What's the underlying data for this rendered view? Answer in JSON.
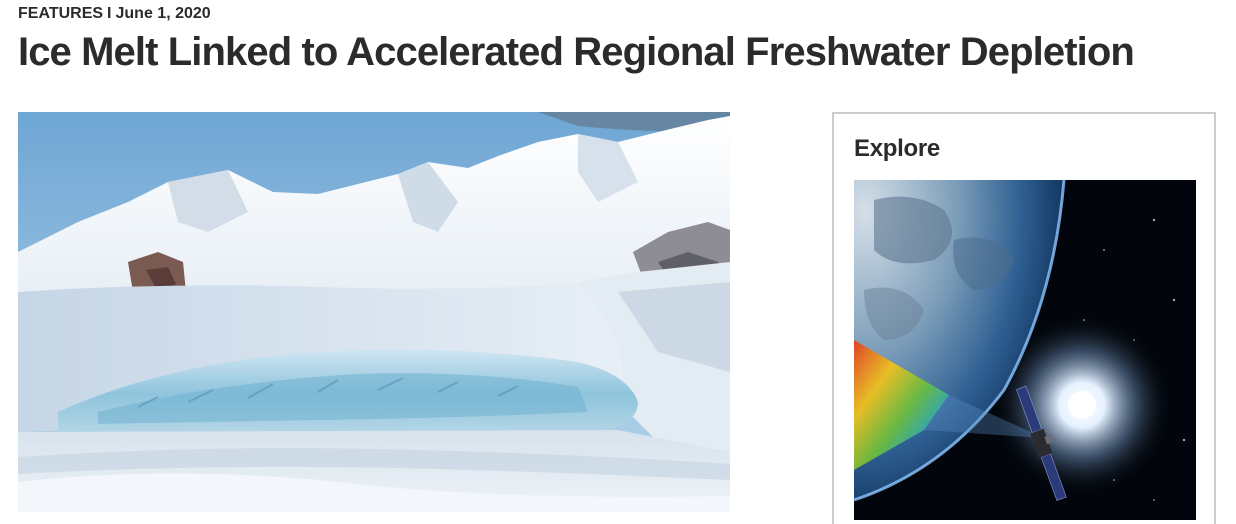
{
  "article": {
    "section": "FEATURES",
    "separator": "I",
    "date": "June 1, 2020",
    "title": "Ice Melt Linked to Accelerated Regional Freshwater Depletion"
  },
  "sidebar": {
    "explore_title": "Explore"
  },
  "images": {
    "hero": "glacier-mountains-photo",
    "explore": "satellite-earth-orbit-illustration"
  }
}
